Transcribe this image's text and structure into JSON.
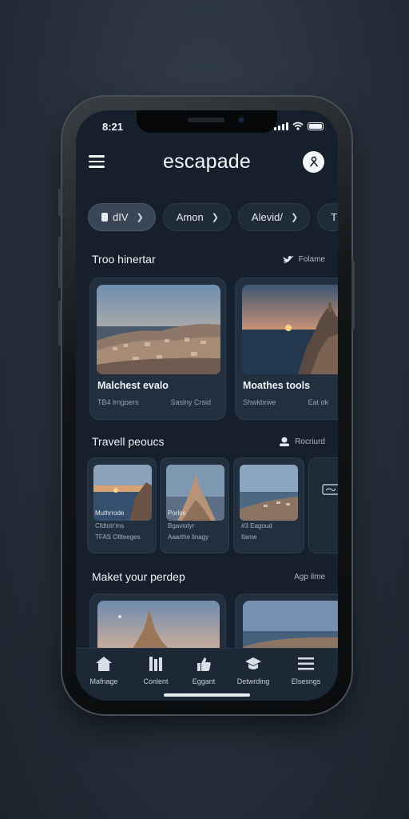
{
  "status_bar": {
    "time": "8:21"
  },
  "header": {
    "app_title": "escapade"
  },
  "filters": [
    {
      "label": "dIV",
      "selected": true
    },
    {
      "label": "Amon",
      "selected": false
    },
    {
      "label": "Alevid/",
      "selected": false
    },
    {
      "label": "T",
      "selected": false
    }
  ],
  "section1": {
    "title": "Troo hinertar",
    "action": "Folame",
    "cards": [
      {
        "title": "Malchest evalo",
        "meta_left": "TB4 lrngoers",
        "meta_right": "Saslny Crsid"
      },
      {
        "title": "Moathes tools",
        "meta_left": "Shwkbrwe",
        "meta_right": "Eat ok"
      }
    ]
  },
  "section2": {
    "title": "Travell peoucs",
    "action": "Rocriurd",
    "cards": [
      {
        "line1": "Muthrrode",
        "line2": "Cfdtotr'ms",
        "line3": "TFAS Oltteeges"
      },
      {
        "line1": "Porlos",
        "line2": "Bgaviotyr",
        "line3": "Aaarthe linagy"
      },
      {
        "line1": "",
        "line2": "#3 Eagoud",
        "line3": "Ilame"
      }
    ]
  },
  "section3": {
    "title": "Maket your perdep",
    "action": "Agp ilme"
  },
  "tabbar": [
    {
      "label": "Mafnage",
      "icon": "home-icon"
    },
    {
      "label": "Conlent",
      "icon": "columns-icon"
    },
    {
      "label": "Eggant",
      "icon": "thumbs-up-icon"
    },
    {
      "label": "Detwrding",
      "icon": "graduation-cap-icon"
    },
    {
      "label": "Elsesngs",
      "icon": "menu-icon"
    }
  ],
  "colors": {
    "background": "#16202c",
    "card": "#222f3e",
    "accent_text": "#f4f6f8"
  }
}
